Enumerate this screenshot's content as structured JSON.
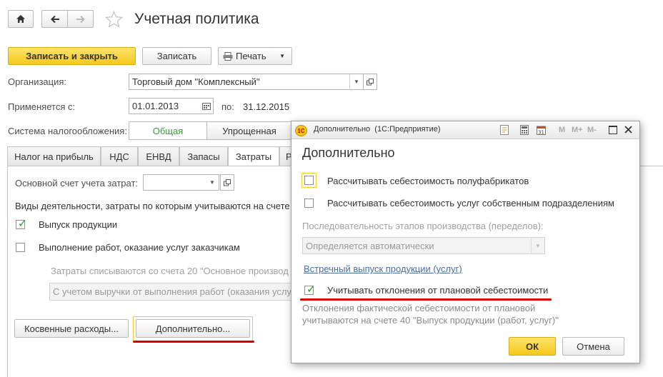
{
  "window": {
    "title": "Учетная политика"
  },
  "toolbar": {
    "save_close": "Записать и закрыть",
    "save": "Записать",
    "print": "Печать"
  },
  "form": {
    "org_label": "Организация:",
    "org_value": "Торговый дом \"Комплексный\"",
    "applies_label": "Применяется с:",
    "applies_from": "01.01.2013",
    "to_label": "по:",
    "applies_to": "31.12.2015",
    "tax_label": "Система налогообложения:",
    "tax_options": [
      "Общая",
      "Упрощенная"
    ]
  },
  "tabs": [
    "Налог на прибыль",
    "НДС",
    "ЕНВД",
    "Запасы",
    "Затраты",
    "Р"
  ],
  "costs": {
    "main_account_label": "Основной счет учета затрат:",
    "main_account_value": "",
    "activities_label": "Виды деятельности, затраты по которым учитываются на счете",
    "option_production": "Выпуск продукции",
    "option_services": "Выполнение работ, оказание услуг заказчикам",
    "writeoff_note": "Затраты списываются со счета 20 \"Основное производ",
    "writeoff_method": "С учетом выручки от выполнения работ (оказания услу",
    "indirect_button": "Косвенные расходы...",
    "additional_button": "Дополнительно..."
  },
  "dialog": {
    "titlebar": "Дополнительно  (1С:Предприятие)",
    "titlebar_icons": [
      "M",
      "M+",
      "M-"
    ],
    "heading": "Дополнительно",
    "opt_semi": "Рассчитывать себестоимость полуфабрикатов",
    "opt_own_services": "Рассчитывать себестоимость услуг собственным подразделениям",
    "sequence_label": "Последовательность этапов производства (переделов):",
    "sequence_value": "Определяется автоматически",
    "counter_link": "Встречный выпуск продукции (услуг)",
    "opt_deviation": "Учитывать отклонения от плановой себестоимости",
    "deviation_note_1": "Отклонения фактической себестоимости от плановой",
    "deviation_note_2": "учитываются на счете 40 \"Выпуск продукции (работ, услуг)\"",
    "ok": "ОК",
    "cancel": "Отмена"
  },
  "colors": {
    "accent_button": "#fbd92f",
    "link": "#4a6fa5",
    "highlight_line": "#d90000",
    "check_mark": "#2b9b2b"
  }
}
